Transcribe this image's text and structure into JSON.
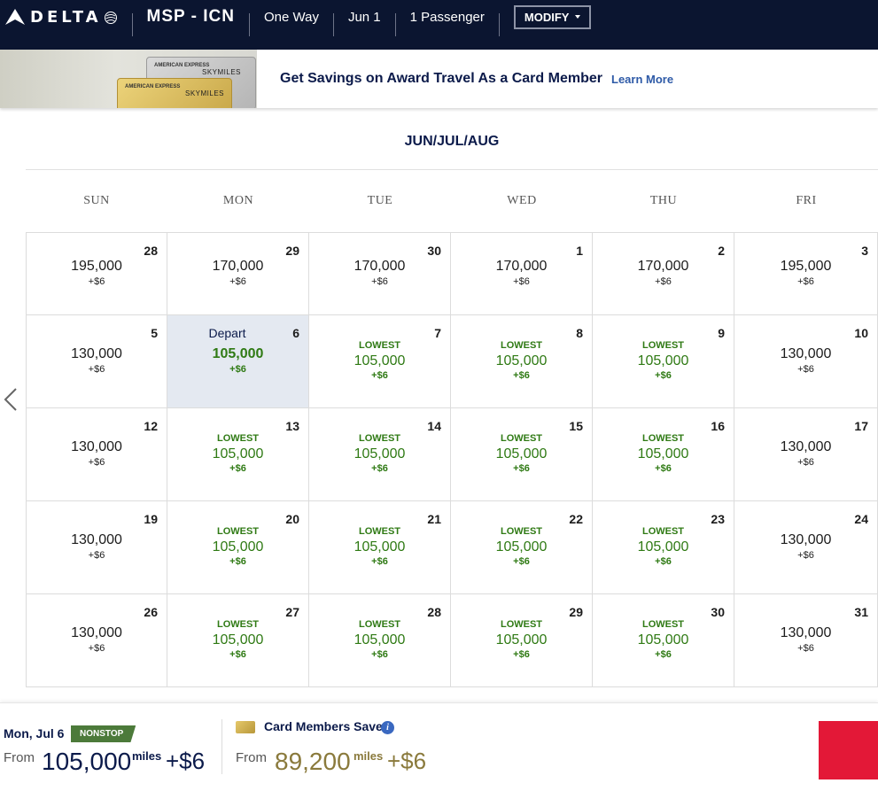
{
  "header": {
    "brand": "DELTA",
    "route": "MSP - ICN",
    "trip_type": "One Way",
    "date": "Jun 1",
    "passengers": "1 Passenger",
    "modify_label": "MODIFY"
  },
  "promo": {
    "card_brand_1": "AMERICAN EXPRESS",
    "card_brand_2": "AMERICAN EXPRESS",
    "card_program_1": "SKYMILES",
    "card_program_2": "SKYMILES",
    "headline": "Get Savings on Award Travel As a Card Member",
    "link": "Learn More"
  },
  "calendar": {
    "month_label": "JUN/JUL/AUG",
    "weekdays": [
      "SUN",
      "MON",
      "TUE",
      "WED",
      "THU",
      "FRI"
    ],
    "depart_label": "Depart",
    "lowest_label": "LOWEST",
    "rows": [
      [
        {
          "day": "28",
          "miles": "195,000",
          "fee": "+$6"
        },
        {
          "day": "29",
          "miles": "170,000",
          "fee": "+$6"
        },
        {
          "day": "30",
          "miles": "170,000",
          "fee": "+$6"
        },
        {
          "day": "1",
          "miles": "170,000",
          "fee": "+$6"
        },
        {
          "day": "2",
          "miles": "170,000",
          "fee": "+$6"
        },
        {
          "day": "3",
          "miles": "195,000",
          "fee": "+$6"
        }
      ],
      [
        {
          "day": "5",
          "miles": "130,000",
          "fee": "+$6"
        },
        {
          "day": "6",
          "miles": "105,000",
          "fee": "+$6",
          "selected": true
        },
        {
          "day": "7",
          "miles": "105,000",
          "fee": "+$6",
          "lowest": true
        },
        {
          "day": "8",
          "miles": "105,000",
          "fee": "+$6",
          "lowest": true
        },
        {
          "day": "9",
          "miles": "105,000",
          "fee": "+$6",
          "lowest": true
        },
        {
          "day": "10",
          "miles": "130,000",
          "fee": "+$6"
        }
      ],
      [
        {
          "day": "12",
          "miles": "130,000",
          "fee": "+$6"
        },
        {
          "day": "13",
          "miles": "105,000",
          "fee": "+$6",
          "lowest": true
        },
        {
          "day": "14",
          "miles": "105,000",
          "fee": "+$6",
          "lowest": true
        },
        {
          "day": "15",
          "miles": "105,000",
          "fee": "+$6",
          "lowest": true
        },
        {
          "day": "16",
          "miles": "105,000",
          "fee": "+$6",
          "lowest": true
        },
        {
          "day": "17",
          "miles": "130,000",
          "fee": "+$6"
        }
      ],
      [
        {
          "day": "19",
          "miles": "130,000",
          "fee": "+$6"
        },
        {
          "day": "20",
          "miles": "105,000",
          "fee": "+$6",
          "lowest": true
        },
        {
          "day": "21",
          "miles": "105,000",
          "fee": "+$6",
          "lowest": true
        },
        {
          "day": "22",
          "miles": "105,000",
          "fee": "+$6",
          "lowest": true
        },
        {
          "day": "23",
          "miles": "105,000",
          "fee": "+$6",
          "lowest": true
        },
        {
          "day": "24",
          "miles": "130,000",
          "fee": "+$6"
        }
      ],
      [
        {
          "day": "26",
          "miles": "130,000",
          "fee": "+$6"
        },
        {
          "day": "27",
          "miles": "105,000",
          "fee": "+$6",
          "lowest": true
        },
        {
          "day": "28",
          "miles": "105,000",
          "fee": "+$6",
          "lowest": true
        },
        {
          "day": "29",
          "miles": "105,000",
          "fee": "+$6",
          "lowest": true
        },
        {
          "day": "30",
          "miles": "105,000",
          "fee": "+$6",
          "lowest": true
        },
        {
          "day": "31",
          "miles": "130,000",
          "fee": "+$6"
        }
      ]
    ]
  },
  "footer": {
    "selected_date": "Mon, Jul 6",
    "nonstop_badge": "NONSTOP",
    "from_label": "From",
    "miles": "105,000",
    "miles_unit": "miles",
    "plus_fee": "+$6",
    "card_members_label": "Card Members Save",
    "info_glyph": "i",
    "card_from_label": "From",
    "card_miles": "89,200",
    "card_miles_unit": "miles",
    "card_plus_fee": "+$6"
  },
  "colors": {
    "header_bg": "#0b1530",
    "lowest_green": "#2f7a14",
    "selected_bg": "#e4e9f1",
    "gold": "#8a7a3c",
    "red": "#e31837"
  },
  "icons": [
    "delta-widget-icon",
    "globe-icon",
    "chevron-left-icon",
    "caret-down-icon",
    "gold-card-icon",
    "info-icon"
  ]
}
